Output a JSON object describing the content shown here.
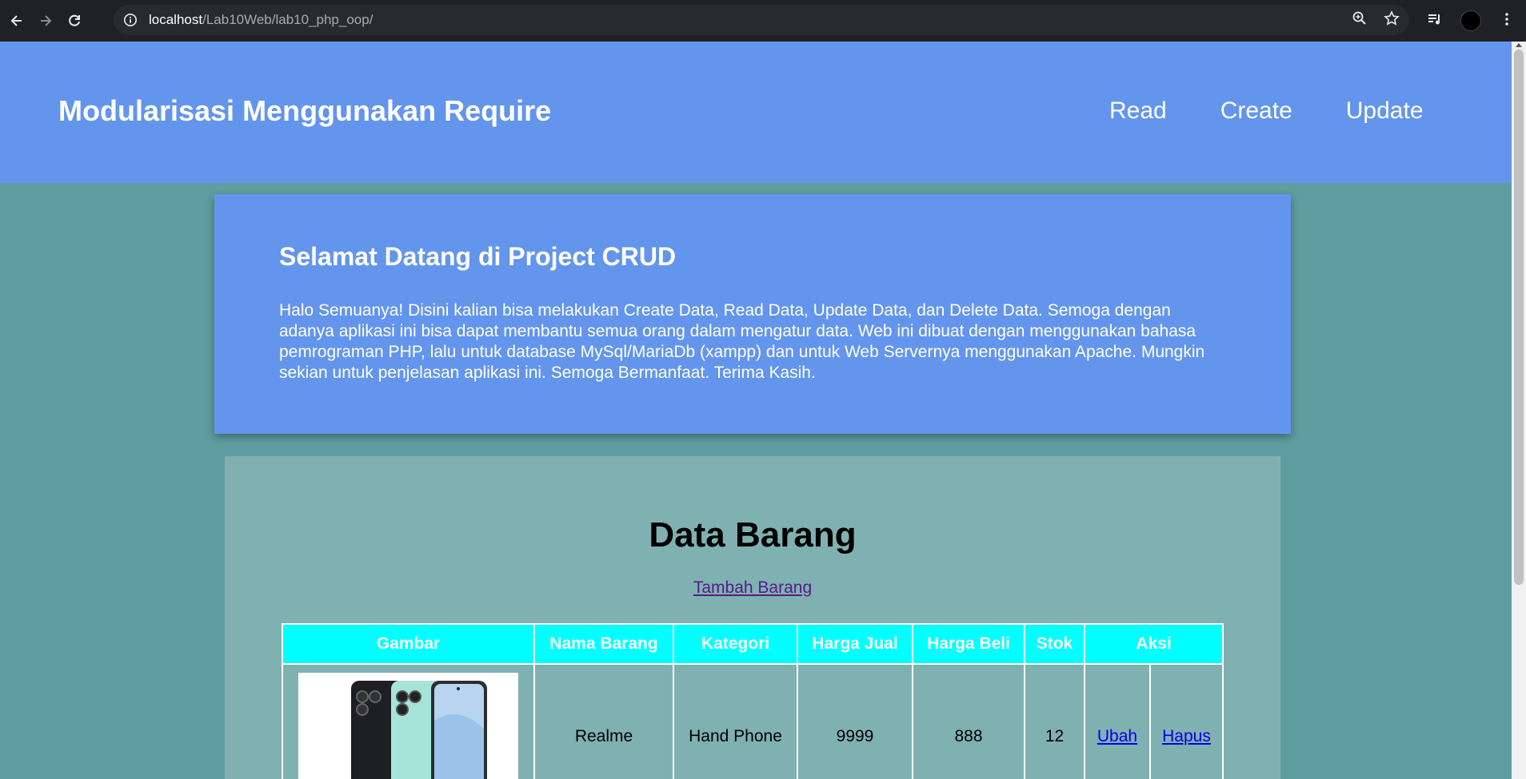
{
  "browser": {
    "url_host": "localhost",
    "url_path": "/Lab10Web/lab10_php_oop/"
  },
  "header": {
    "brand": "Modularisasi Menggunakan Require",
    "nav": [
      "Read",
      "Create",
      "Update"
    ]
  },
  "welcome": {
    "title": "Selamat Datang di Project CRUD",
    "body": "Halo Semuanya! Disini kalian bisa melakukan Create Data, Read Data, Update Data, dan Delete Data. Semoga dengan adanya aplikasi ini bisa dapat membantu semua orang dalam mengatur data. Web ini dibuat dengan menggunakan bahasa pemrograman PHP, lalu untuk database MySql/MariaDb (xampp) dan untuk Web Servernya menggunakan Apache. Mungkin sekian untuk penjelasan aplikasi ini. Semoga Bermanfaat. Terima Kasih."
  },
  "content": {
    "title": "Data Barang",
    "add_link": "Tambah Barang",
    "columns": [
      "Gambar",
      "Nama Barang",
      "Kategori",
      "Harga Jual",
      "Harga Beli",
      "Stok",
      "Aksi"
    ],
    "rows": [
      {
        "nama": "Realme",
        "kategori": "Hand Phone",
        "harga_jual": "9999",
        "harga_beli": "888",
        "stok": "12",
        "ubah": "Ubah",
        "hapus": "Hapus"
      }
    ]
  },
  "colors": {
    "header_bg": "#6495ed",
    "page_bg": "#5f9ea0",
    "content_bg": "#80b1b1",
    "table_header_bg": "#00ffff"
  }
}
